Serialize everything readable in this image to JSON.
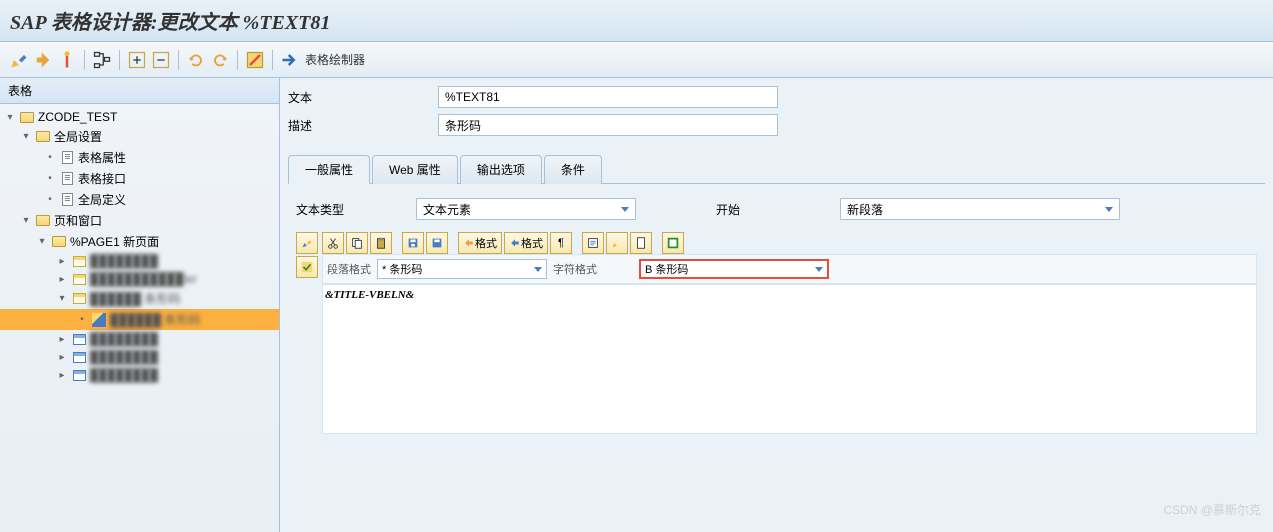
{
  "title": "SAP 表格设计器:更改文本 %TEXT81",
  "toolbar": {
    "painter_label": "表格绘制器"
  },
  "tree": {
    "header": "表格",
    "root": "ZCODE_TEST",
    "global": "全局设置",
    "global_items": [
      "表格属性",
      "表格接口",
      "全局定义"
    ],
    "pages": "页和窗口",
    "page1": "%PAGE1 新页面",
    "items": [
      {
        "label": "████████",
        "blur": true
      },
      {
        "label": "███████████ler",
        "blur": true
      },
      {
        "label": "██████ 条形码",
        "blur": true,
        "expanded": true,
        "children": [
          {
            "label": "██████ 条形码",
            "blur": true,
            "selected": true
          }
        ]
      },
      {
        "label": "████████",
        "blur": true
      },
      {
        "label": "████████",
        "blur": true
      },
      {
        "label": "████████",
        "blur": true
      }
    ]
  },
  "fields": {
    "text_label": "文本",
    "text_value": "%TEXT81",
    "desc_label": "描述",
    "desc_value": "条形码"
  },
  "tabs": [
    "一般属性",
    "Web 属性",
    "输出选项",
    "条件"
  ],
  "active_tab": 0,
  "type_section": {
    "text_type_label": "文本类型",
    "text_type_value": "文本元素",
    "start_label": "开始",
    "start_value": "新段落"
  },
  "sub_toolbar": {
    "para_label": "段落格式",
    "para_value": "* 条形码",
    "char_label": "字符格式",
    "char_value": "B 条形码"
  },
  "editor_toolbar_labels": {
    "fmt1": "格式",
    "fmt2": "格式"
  },
  "editor_content": "&TITLE-VBELN&",
  "watermark": "CSDN @慕斯尔克"
}
